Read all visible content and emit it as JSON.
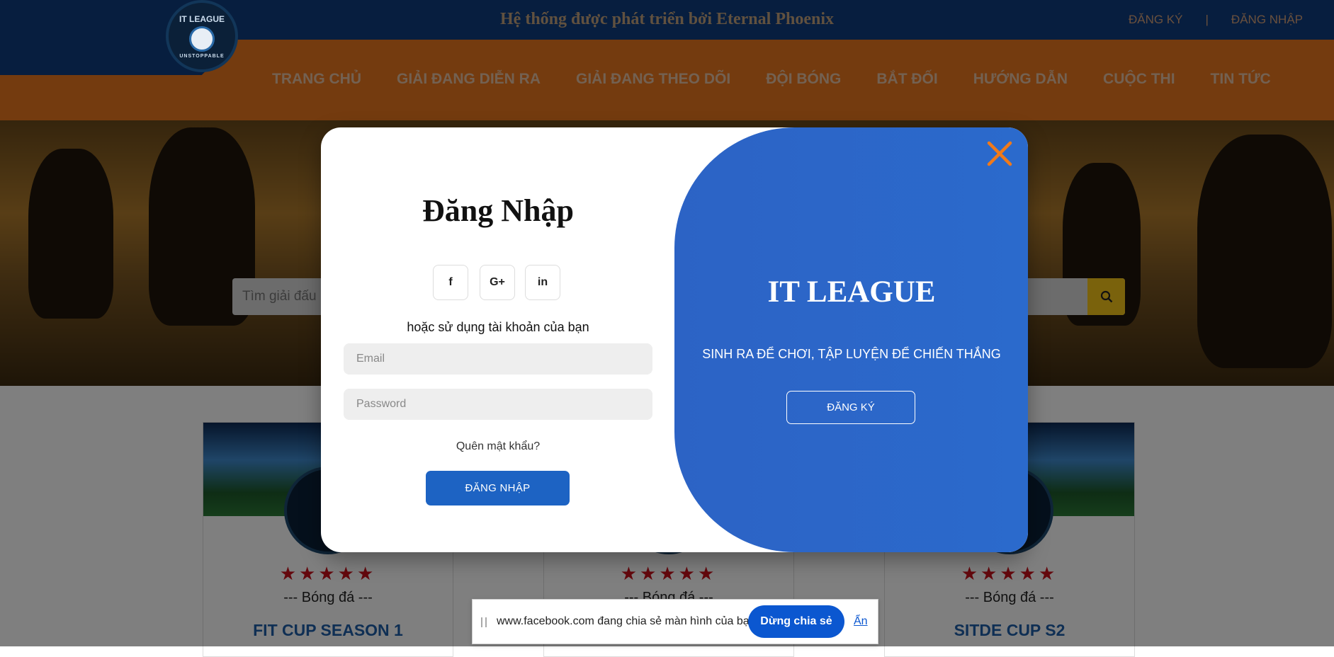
{
  "header": {
    "logo_text": "IT LEAGUE",
    "logo_sub": "UNSTOPPABLE",
    "developer_text": "Hệ thống được phát triển bởi Eternal Phoenix",
    "register_link": "ĐĂNG KÝ",
    "separator": "|",
    "login_link": "ĐĂNG NHẬP"
  },
  "nav": {
    "items": [
      "TRANG CHỦ",
      "GIẢI ĐANG DIỄN RA",
      "GIẢI ĐANG THEO DÕI",
      "ĐỘI BÓNG",
      "BẮT ĐỐI",
      "HƯỚNG DẪN",
      "CUỘC THI",
      "TIN TỨC"
    ]
  },
  "hero": {
    "search_placeholder": "Tìm giải đấu"
  },
  "cards": [
    {
      "stars": "★★★★★",
      "sport": "--- Bóng đá ---",
      "name": "FIT CUP SEASON 1"
    },
    {
      "stars": "★★★★★",
      "sport": "--- Bóng đá ---",
      "name": ""
    },
    {
      "stars": "★★★★★",
      "sport": "--- Bóng đá ---",
      "name": "SITDE CUP S2"
    }
  ],
  "modal": {
    "title": "Đăng Nhập",
    "social": [
      "f",
      "G+",
      "in"
    ],
    "or_text": "hoặc sử dụng tài khoản của bạn",
    "email_placeholder": "Email",
    "password_placeholder": "Password",
    "forgot": "Quên mật khẩu?",
    "login_button": "ĐĂNG NHẬP",
    "brand": "IT LEAGUE",
    "tagline": "SINH RA ĐỂ CHƠI, TẬP LUYỆN ĐỂ CHIẾN THẮNG",
    "register_button": "ĐĂNG KÝ"
  },
  "sharebar": {
    "message": "www.facebook.com đang chia sẻ màn hình của bạn.",
    "stop_button": "Dừng chia sẻ",
    "hide_link": "Ẩn"
  },
  "colors": {
    "header_blue": "#0f3d7e",
    "nav_orange": "#e8761e",
    "modal_blue": "#2c63c5",
    "close_orange": "#f07a1a"
  },
  "icons": [
    "search-icon",
    "facebook-icon",
    "google-plus-icon",
    "linkedin-icon",
    "close-icon",
    "star-icon"
  ]
}
